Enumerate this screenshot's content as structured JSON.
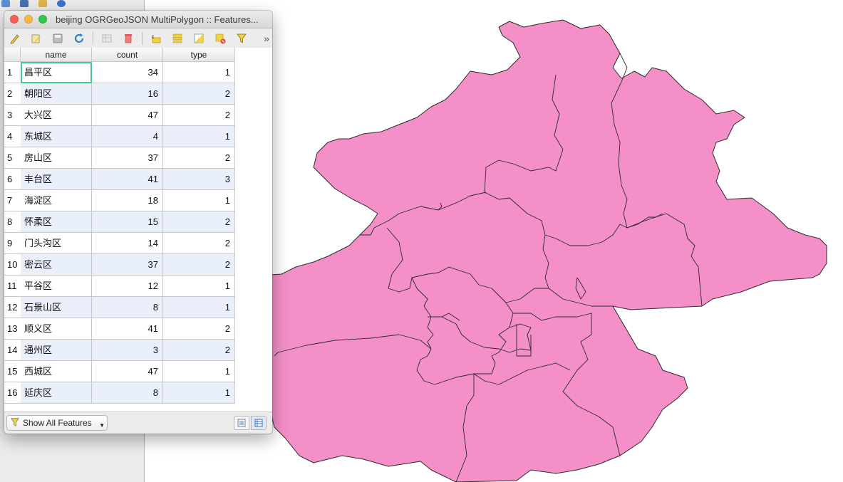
{
  "window": {
    "title": "beijing OGRGeoJSON MultiPolygon :: Features..."
  },
  "toolbar": {
    "icons": [
      "toggle-editing-icon",
      "multi-edit-icon",
      "save-edits-icon",
      "reload-icon",
      "add-feature-icon",
      "delete-selected-icon",
      "select-by-expression-icon",
      "select-all-icon",
      "invert-selection-icon",
      "deselect-all-icon",
      "filter-icon"
    ],
    "more": "»"
  },
  "table": {
    "columns": [
      "name",
      "count",
      "type"
    ],
    "rows": [
      {
        "n": "1",
        "name": "昌平区",
        "count": "34",
        "type": "1"
      },
      {
        "n": "2",
        "name": "朝阳区",
        "count": "16",
        "type": "2"
      },
      {
        "n": "3",
        "name": "大兴区",
        "count": "47",
        "type": "2"
      },
      {
        "n": "4",
        "name": "东城区",
        "count": "4",
        "type": "1"
      },
      {
        "n": "5",
        "name": "房山区",
        "count": "37",
        "type": "2"
      },
      {
        "n": "6",
        "name": "丰台区",
        "count": "41",
        "type": "3"
      },
      {
        "n": "7",
        "name": "海淀区",
        "count": "18",
        "type": "1"
      },
      {
        "n": "8",
        "name": "怀柔区",
        "count": "15",
        "type": "2"
      },
      {
        "n": "9",
        "name": "门头沟区",
        "count": "14",
        "type": "2"
      },
      {
        "n": "10",
        "name": "密云区",
        "count": "37",
        "type": "2"
      },
      {
        "n": "11",
        "name": "平谷区",
        "count": "12",
        "type": "1"
      },
      {
        "n": "12",
        "name": "石景山区",
        "count": "8",
        "type": "1"
      },
      {
        "n": "13",
        "name": "顺义区",
        "count": "41",
        "type": "2"
      },
      {
        "n": "14",
        "name": "通州区",
        "count": "3",
        "type": "2"
      },
      {
        "n": "15",
        "name": "西城区",
        "count": "47",
        "type": "1"
      },
      {
        "n": "16",
        "name": "延庆区",
        "count": "8",
        "type": "1"
      }
    ],
    "selected_row": 0
  },
  "footer": {
    "filter_label": "Show All Features"
  },
  "colors": {
    "polygon_fill": "#f48fc8",
    "polygon_stroke": "#2a2a2a",
    "selection_outline": "#42c98e",
    "alt_row": "#e9effb"
  }
}
